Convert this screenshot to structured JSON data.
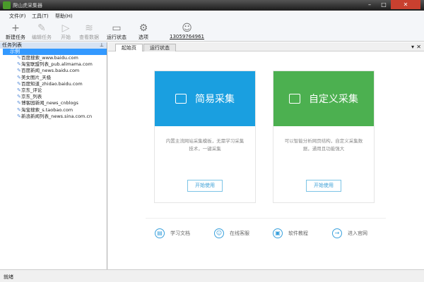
{
  "window": {
    "title": "爬山虎采集器",
    "min": "–",
    "max": "□",
    "close": "✕"
  },
  "menu": [
    "文件(F)",
    "工具(T)",
    "帮助(H)"
  ],
  "toolbar": [
    {
      "label": "新建任务",
      "icon": "+",
      "disabled": false
    },
    {
      "label": "编辑任务",
      "icon": "✎",
      "disabled": true
    },
    {
      "label": "开始",
      "icon": "▷",
      "disabled": true
    },
    {
      "label": "查看数据",
      "icon": "≋",
      "disabled": true
    },
    {
      "label": "运行状态",
      "icon": "▭",
      "disabled": false
    },
    {
      "label": "选项",
      "icon": "⚙",
      "disabled": false
    }
  ],
  "user": {
    "phone": "13059764961",
    "icon": "☺"
  },
  "task_panel": {
    "title": "任务列表",
    "pin": "⊥",
    "root": "示例",
    "items": [
      "百度搜索_www.baidu.com",
      "淘宝联盟列表_pub.alimama.com",
      "百度新闻_news.baidu.com",
      "美女图片_天极",
      "百度知道_zhidao.baidu.com",
      "京东_评论",
      "京东_列表",
      "博客园新闻_news_cnblogs",
      "淘宝搜索_s.taobao.com",
      "新浪新闻列表_news.sina.com.cn"
    ]
  },
  "tabs": [
    "起始页",
    "运行状态"
  ],
  "tab_controls": {
    "dropdown": "▾",
    "close": "✕"
  },
  "cards": [
    {
      "title": "简易采集",
      "desc": "内置主流网站采集模板，无需学习采集技术，一键采集",
      "button": "开始使用",
      "color": "#1a9fe0"
    },
    {
      "title": "自定义采集",
      "desc": "可以智能分析网页结构，自定义采集数据，通用且功能强大",
      "button": "开始使用",
      "color": "#4cb050"
    }
  ],
  "links": [
    {
      "label": "学习文档",
      "icon": "▤"
    },
    {
      "label": "在线客服",
      "icon": "☺"
    },
    {
      "label": "软件教程",
      "icon": "▣"
    },
    {
      "label": "进入官网",
      "icon": "→"
    }
  ],
  "status": "就绪"
}
